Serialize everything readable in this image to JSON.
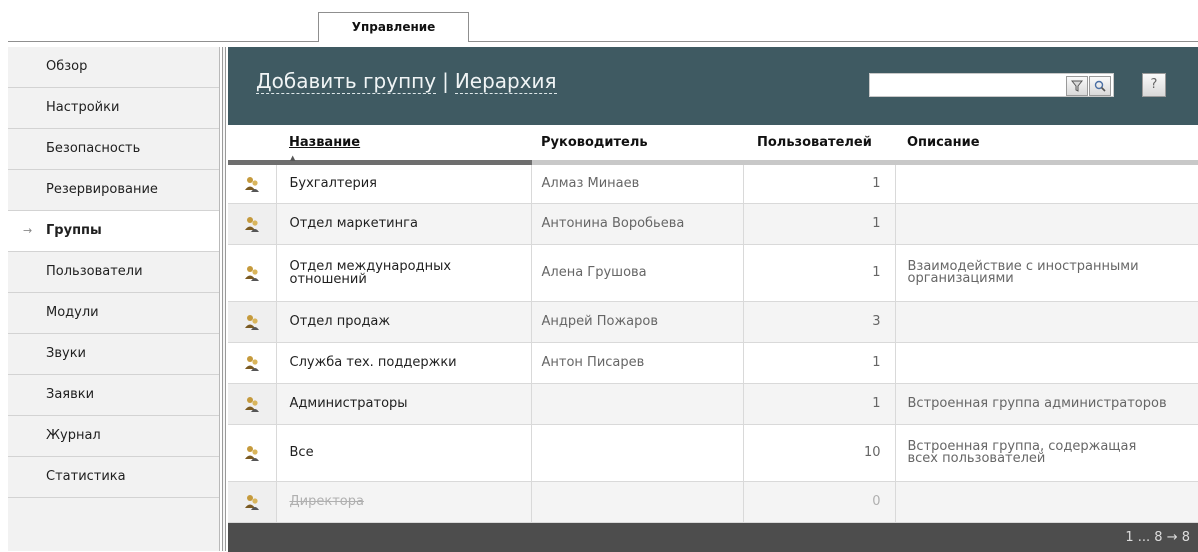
{
  "tabs": [
    {
      "label": "Управление",
      "active": true
    }
  ],
  "sidebar": {
    "active_marker": "→",
    "items": [
      {
        "label": "Обзор"
      },
      {
        "label": "Настройки"
      },
      {
        "label": "Безопасность"
      },
      {
        "label": "Резервирование"
      },
      {
        "label": "Группы",
        "active": true
      },
      {
        "label": "Пользователи"
      },
      {
        "label": "Модули"
      },
      {
        "label": "Звуки"
      },
      {
        "label": "Заявки"
      },
      {
        "label": "Журнал"
      },
      {
        "label": "Статистика"
      }
    ]
  },
  "header": {
    "add_group_link": "Добавить группу",
    "separator": "|",
    "hierarchy_link": "Иерархия",
    "search": {
      "value": "",
      "placeholder": ""
    },
    "filter_icon": "filter-icon",
    "search_icon": "magnifier-icon",
    "help_label": "?"
  },
  "table": {
    "columns": [
      "Название",
      "Руководитель",
      "Пользователей",
      "Описание"
    ],
    "sorted_column": "Название",
    "rows": [
      {
        "name": "Бухгалтерия",
        "manager": "Алмаз Минаев",
        "users": "1",
        "description": ""
      },
      {
        "name": "Отдел маркетинга",
        "manager": "Антонина Воробьева",
        "users": "1",
        "description": ""
      },
      {
        "name": "Отдел международных отношений",
        "manager": "Алена Грушова",
        "users": "1",
        "description": "Взаимодействие с иностранными организациями"
      },
      {
        "name": "Отдел продаж",
        "manager": "Андрей Пожаров",
        "users": "3",
        "description": ""
      },
      {
        "name": "Служба тех. поддержки",
        "manager": "Антон Писарев",
        "users": "1",
        "description": ""
      },
      {
        "name": "Администраторы",
        "manager": "",
        "users": "1",
        "description": "Встроенная группа администраторов"
      },
      {
        "name": "Все",
        "manager": "",
        "users": "10",
        "description": "Встроенная группа, содержащая всех пользователей"
      },
      {
        "name": "Директора",
        "manager": "",
        "users": "0",
        "description": "",
        "disabled": true
      }
    ]
  },
  "pagination": {
    "text": "1 ... 8 → 8"
  },
  "colors": {
    "header_bg": "#3f5a62",
    "footer_bg": "#4d4d4d",
    "sidebar_bg": "#f2f2f2",
    "active_item_bg": "#ffffff"
  }
}
